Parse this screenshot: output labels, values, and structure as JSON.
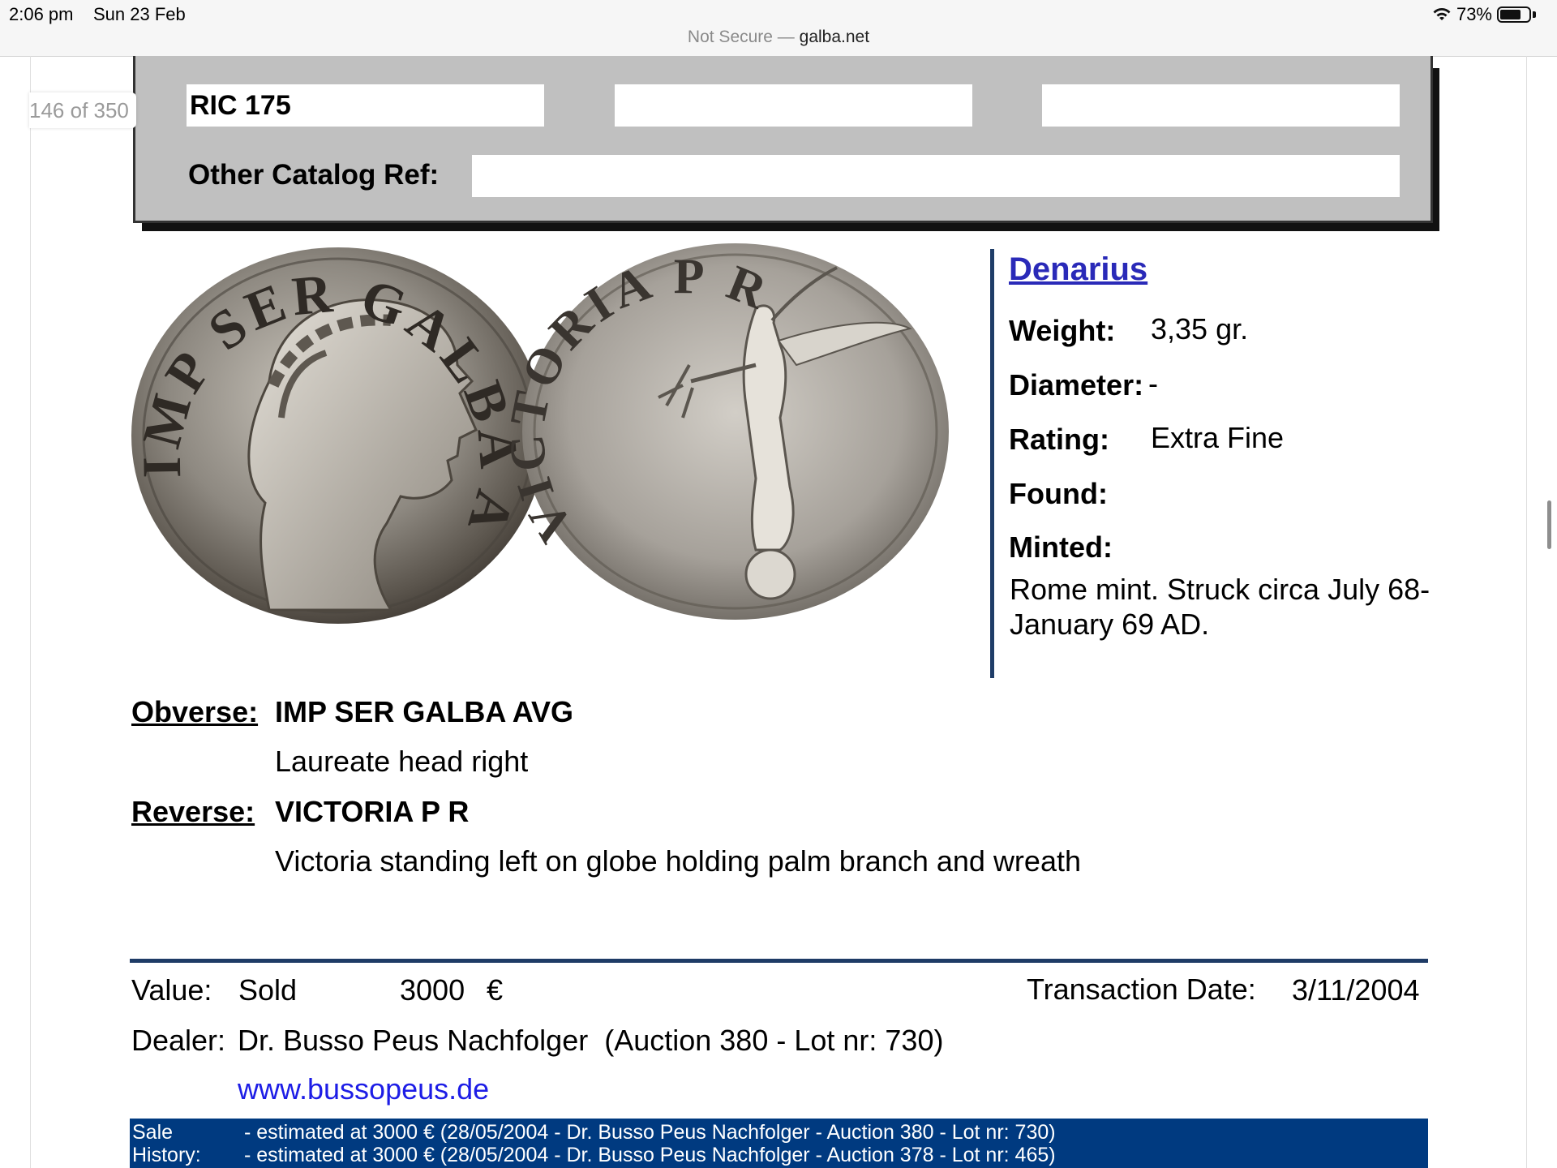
{
  "status_bar": {
    "time": "2:06 pm",
    "date": "Sun 23 Feb",
    "battery_text": "73%",
    "battery_level": 0.73,
    "icons": [
      "wifi-icon",
      "battery-icon"
    ]
  },
  "address_bar": {
    "security": "Not Secure —",
    "host": "galba.net"
  },
  "page_counter": "146 of 350",
  "catalog": {
    "ric": "RIC 175",
    "ref2": "",
    "ref3": "",
    "other_label": "Other Catalog Ref:",
    "other_value": ""
  },
  "coin_images": {
    "obverse_alt": "IMP SER GALBA AVG",
    "reverse_alt": "VICTORIA P R"
  },
  "details": {
    "denomination": "Denarius",
    "weight_label": "Weight:",
    "weight": "3,35 gr.",
    "diameter_label": "Diameter:",
    "diameter": "-",
    "rating_label": "Rating:",
    "rating": "Extra Fine",
    "found_label": "Found:",
    "found": "",
    "minted_label": "Minted:",
    "minted": "Rome mint. Struck circa July 68-January 69 AD."
  },
  "obverse": {
    "label": "Obverse:",
    "legend": "IMP SER GALBA AVG",
    "description": "Laureate head right"
  },
  "reverse": {
    "label": "Reverse:",
    "legend": "VICTORIA P R",
    "description": "Victoria standing left on globe holding palm branch and wreath"
  },
  "transaction": {
    "value_label": "Value:",
    "status": "Sold",
    "amount": "3000",
    "currency": "€",
    "date_label": "Transaction Date:",
    "date": "3/11/2004",
    "dealer_label": "Dealer:",
    "dealer": "Dr. Busso Peus Nachfolger  (Auction 380 - Lot nr: 730)",
    "website": "www.bussopeus.de"
  },
  "sale_history": {
    "label_line1": "Sale",
    "label_line2": "History:",
    "rows": [
      "- estimated at 3000 € (28/05/2004 - Dr. Busso Peus Nachfolger - Auction 380 - Lot nr: 730)",
      "- estimated at 3000 € (28/05/2004 - Dr. Busso Peus Nachfolger - Auction 378 - Lot nr: 465)"
    ]
  },
  "colors": {
    "catalog_bg": "#c0c0c0",
    "accent_blue": "#1e3b66",
    "history_bg": "#003a80",
    "link": "#1d1de6",
    "denomination_link": "#2a2ab8"
  }
}
